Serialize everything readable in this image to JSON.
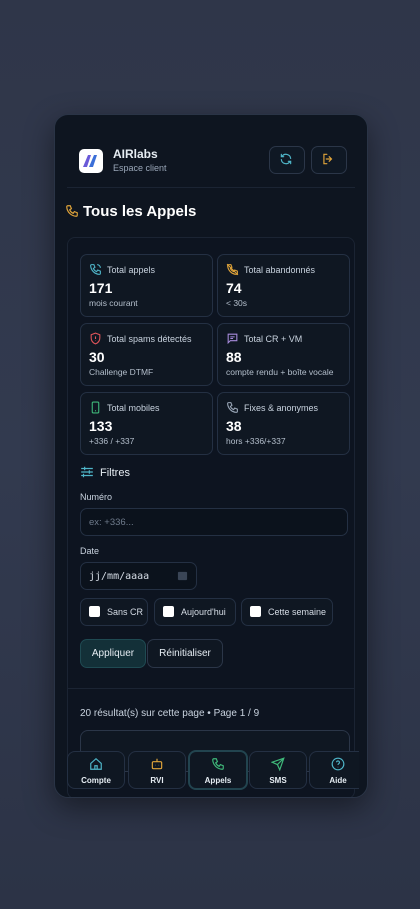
{
  "app": {
    "brand": "AIRlabs",
    "subtitle": "Espace client"
  },
  "section": {
    "title": "Tous les Appels"
  },
  "stats": [
    {
      "label": "Total appels",
      "value": "171",
      "sub": "mois courant",
      "icon": "phone-icon",
      "color": "#4fb6c9"
    },
    {
      "label": "Total abandonnés",
      "value": "74",
      "sub": "< 30s",
      "icon": "phone-off-icon",
      "color": "#e0a43a"
    },
    {
      "label": "Total spams détectés",
      "value": "30",
      "sub": "Challenge DTMF",
      "icon": "shield-icon",
      "color": "#e0545a"
    },
    {
      "label": "Total CR + VM",
      "value": "88",
      "sub": "compte rendu + boîte vocale",
      "icon": "message-icon",
      "color": "#a78bdb"
    },
    {
      "label": "Total mobiles",
      "value": "133",
      "sub": "+336 / +337",
      "icon": "mobile-icon",
      "color": "#3fb97a"
    },
    {
      "label": "Fixes & anonymes",
      "value": "38",
      "sub": "hors +336/+337",
      "icon": "phone-fixed-icon",
      "color": "#9aa7b8"
    }
  ],
  "filters": {
    "title": "Filtres",
    "number_label": "Numéro",
    "number_placeholder": "ex: +336...",
    "date_label": "Date",
    "date_value": "jj/mm/aaaa",
    "checkboxes": [
      "Sans CR",
      "Aujourd'hui",
      "Cette semaine"
    ],
    "apply": "Appliquer",
    "reset": "Réinitialiser"
  },
  "results": {
    "summary": "20 résultat(s) sur cette page • Page 1 / 9"
  },
  "nav": [
    {
      "label": "Compte",
      "icon": "home-icon"
    },
    {
      "label": "RVI",
      "icon": "robot-icon"
    },
    {
      "label": "Appels",
      "icon": "phone-icon",
      "active": true
    },
    {
      "label": "SMS",
      "icon": "send-icon"
    },
    {
      "label": "Aide",
      "icon": "help-icon"
    }
  ],
  "colors": {
    "accent": "#4fb6c9",
    "logout": "#e0a43a",
    "background": "#0e1520"
  }
}
